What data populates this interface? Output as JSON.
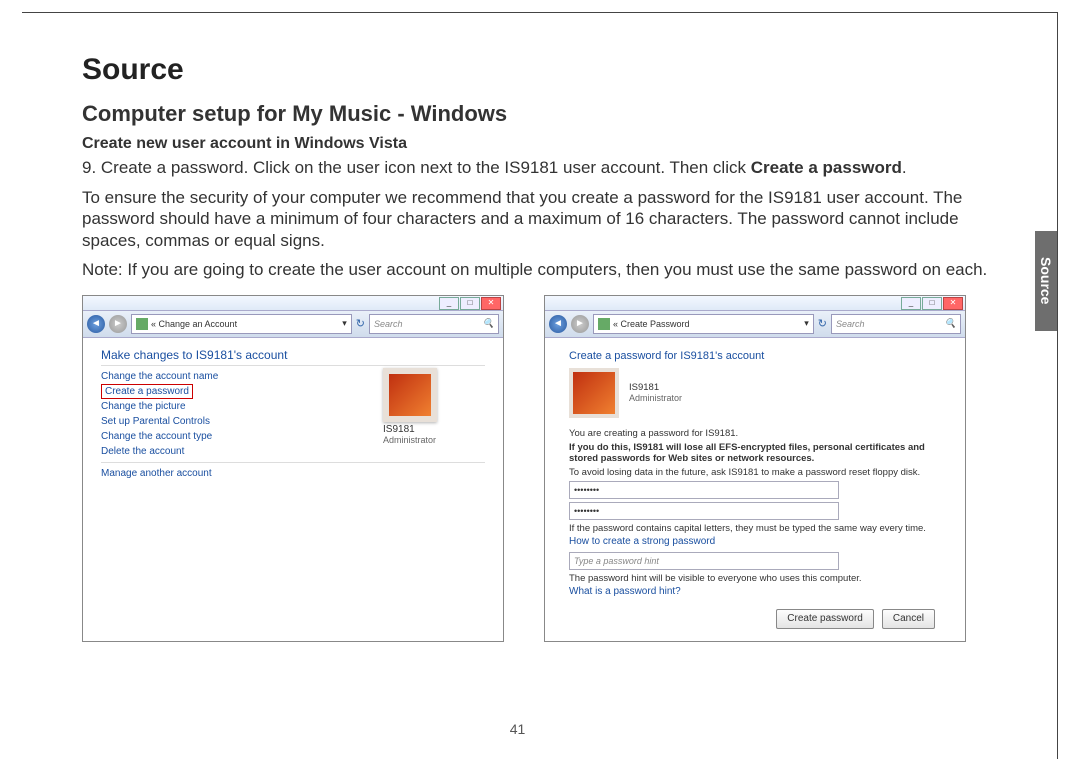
{
  "sideTab": "Source",
  "title": "Source",
  "subtitle": "Computer setup for My Music - Windows",
  "section": "Create new user account in Windows Vista",
  "para1_a": "9. Create a password. Click on the user icon next to the IS9181 user account. Then click ",
  "para1_b": "Create a password",
  "para1_c": ".",
  "para2": "To ensure the security of your computer we recommend that you create a password for the IS9181 user account. The password should have a minimum of four characters and a maximum of 16 characters. The password cannot include spaces, commas or equal signs.",
  "para3": "Note: If you are going to create the user account on multiple computers, then you must use the same password on each.",
  "pageNum": "41",
  "win1": {
    "breadcrumb": "«  Change an Account",
    "searchPlaceholder": "Search",
    "heading": "Make changes to IS9181's account",
    "links": [
      "Change the account name",
      "Create a password",
      "Change the picture",
      "Set up Parental Controls",
      "Change the account type",
      "Delete the account"
    ],
    "bottomLink": "Manage another account",
    "userName": "IS9181",
    "userRole": "Administrator"
  },
  "win2": {
    "breadcrumb": "«  Create Password",
    "searchPlaceholder": "Search",
    "heading": "Create a password for IS9181's account",
    "userName": "IS9181",
    "userRole": "Administrator",
    "line1": "You are creating a password for IS9181.",
    "line2": "If you do this, IS9181 will lose all EFS-encrypted files, personal certificates and stored passwords for Web sites or network resources.",
    "line3": "To avoid losing data in the future, ask IS9181 to make a password reset floppy disk.",
    "pwMask": "••••••••",
    "capHelp": "If the password contains capital letters, they must be typed the same way every time.",
    "strongLink": "How to create a strong password",
    "hintPlaceholder": "Type a password hint",
    "hintHelp": "The password hint will be visible to everyone who uses this computer.",
    "hintLink": "What is a password hint?",
    "btnCreate": "Create password",
    "btnCancel": "Cancel"
  }
}
